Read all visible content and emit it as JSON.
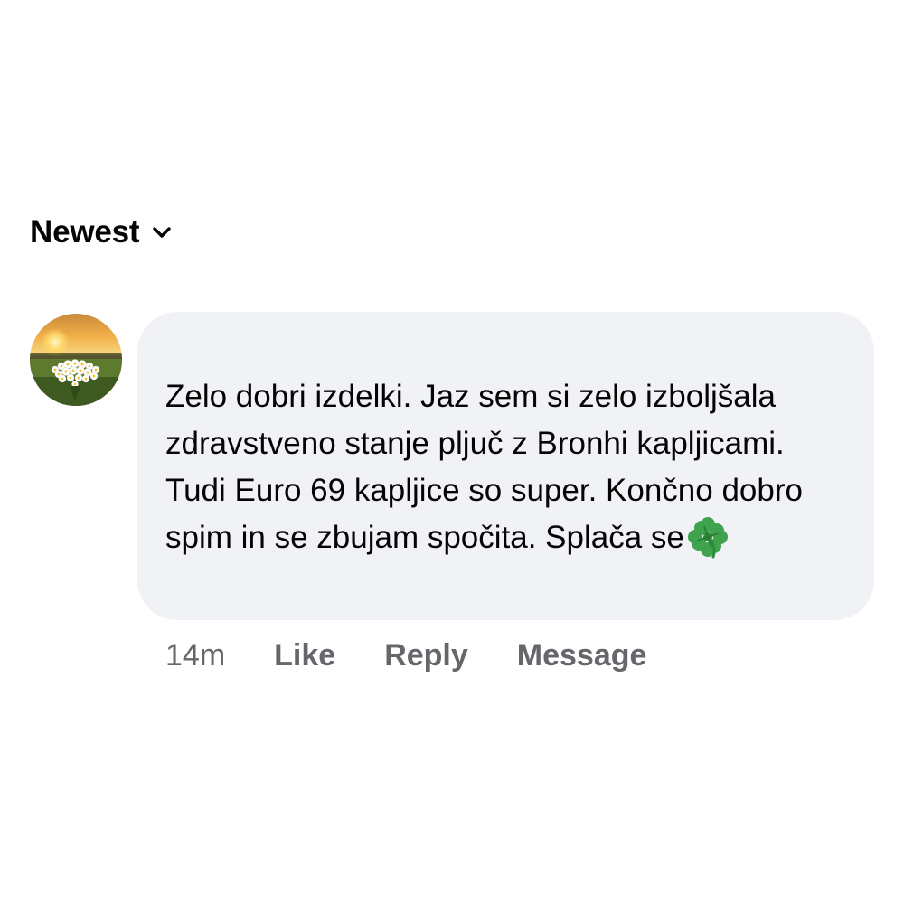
{
  "sort": {
    "label": "Newest",
    "icon": "chevron-down-icon"
  },
  "comment": {
    "avatar_icon": "daisy-field-sunset-avatar",
    "author": "",
    "text": "Zelo dobri izdelki. Jaz sem si zelo izboljšala zdravstveno stanje pljuč z Bronhi kapljicami. Tudi Euro 69 kapljice so super. Končno dobro spim in se zbujam spočita. Splača se",
    "emoji": "four-leaf-clover-icon",
    "bubble_color": "#f0f2f5",
    "timestamp": "14m",
    "actions": {
      "like": "Like",
      "reply": "Reply",
      "message": "Message"
    },
    "action_color": "#65676b"
  }
}
